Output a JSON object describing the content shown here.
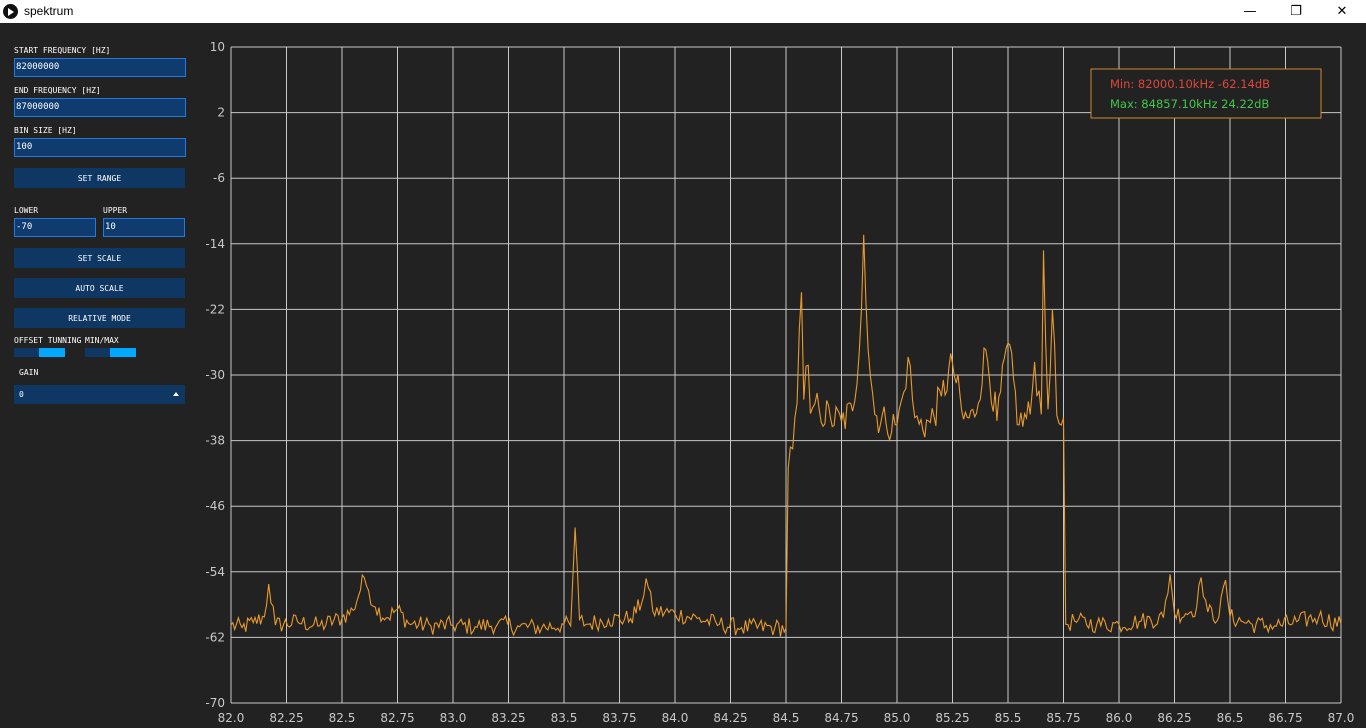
{
  "window": {
    "title": "spektrum",
    "minimize_glyph": "—",
    "restore_glyph": "❐",
    "close_glyph": "✕"
  },
  "sidebar": {
    "start_freq_label": "START FREQUENCY [HZ]",
    "start_freq_value": "82000000",
    "end_freq_label": "END FREQUENCY [HZ]",
    "end_freq_value": "87000000",
    "bin_size_label": "BIN SIZE [HZ]",
    "bin_size_value": "100",
    "set_range_label": "SET RANGE",
    "lower_label": "LOWER",
    "lower_value": "-70",
    "upper_label": "UPPER",
    "upper_value": "10",
    "set_scale_label": "SET SCALE",
    "auto_scale_label": "AUTO SCALE",
    "relative_mode_label": "RELATIVE MODE",
    "offset_tuning_label": "OFFSET TUNNING",
    "offset_tuning_on": true,
    "minmax_label": "MIN/MAX",
    "minmax_on": true,
    "gain_label": "GAIN",
    "gain_value": "0"
  },
  "readout": {
    "min_text": "Min: 82000.10kHz -62.14dB",
    "max_text": "Max: 84857.10kHz 24.22dB",
    "min_color": "#e0463a",
    "max_color": "#3fc84a"
  },
  "chart_data": {
    "type": "line",
    "xlabel": "",
    "ylabel": "",
    "xlim": [
      82.0,
      87.0
    ],
    "ylim": [
      -70,
      10
    ],
    "x_ticks": [
      "82.0",
      "82.25",
      "82.5",
      "82.75",
      "83.0",
      "83.25",
      "83.5",
      "83.75",
      "84.0",
      "84.25",
      "84.5",
      "84.75",
      "85.0",
      "85.25",
      "85.5",
      "85.75",
      "86.0",
      "86.25",
      "86.5",
      "86.75",
      "87.0"
    ],
    "y_ticks": [
      "10",
      "2",
      "-6",
      "-14",
      "-22",
      "-30",
      "-38",
      "-46",
      "-54",
      "-62",
      "-70"
    ],
    "grid": true,
    "line_color": "#e89a2c",
    "series": [
      {
        "x": [
          82.0,
          82.05,
          82.1,
          82.15,
          82.17,
          82.2,
          82.3,
          82.4,
          82.5,
          82.55,
          82.6,
          82.62,
          82.65,
          82.7,
          82.75,
          82.8,
          82.9,
          83.0,
          83.1,
          83.2,
          83.3,
          83.4,
          83.5,
          83.53,
          83.55,
          83.57,
          83.6,
          83.7,
          83.8,
          83.85,
          83.87,
          83.9,
          84.0,
          84.1,
          84.2,
          84.3,
          84.45,
          84.5,
          84.51,
          84.53,
          84.55,
          84.56,
          84.57,
          84.58,
          84.6,
          84.61,
          84.63,
          84.65,
          84.7,
          84.75,
          84.8,
          84.83,
          84.85,
          84.87,
          84.9,
          84.95,
          85.0,
          85.03,
          85.05,
          85.08,
          85.1,
          85.15,
          85.2,
          85.25,
          85.3,
          85.35,
          85.4,
          85.45,
          85.5,
          85.55,
          85.6,
          85.62,
          85.65,
          85.66,
          85.68,
          85.7,
          85.72,
          85.74,
          85.75,
          85.76,
          85.8,
          85.9,
          86.0,
          86.1,
          86.2,
          86.23,
          86.25,
          86.3,
          86.35,
          86.37,
          86.4,
          86.45,
          86.48,
          86.5,
          86.55,
          86.6,
          86.7,
          86.8,
          86.9,
          87.0
        ],
        "y": [
          -60.5,
          -60.8,
          -60.2,
          -59.5,
          -55.5,
          -60.5,
          -60.1,
          -60.6,
          -59.6,
          -58.7,
          -54.7,
          -56.3,
          -58.3,
          -59.6,
          -58.6,
          -60.3,
          -60.6,
          -60.5,
          -60.7,
          -60.4,
          -60.7,
          -60.8,
          -60.4,
          -60.6,
          -48.6,
          -59.8,
          -60.4,
          -59.8,
          -59.7,
          -57.8,
          -54.8,
          -58.8,
          -59.1,
          -59.7,
          -60.4,
          -60.8,
          -60.8,
          -60.9,
          -41.4,
          -39.0,
          -33.4,
          -24.5,
          -19.9,
          -33.0,
          -28.8,
          -34.7,
          -33.5,
          -34.3,
          -35.2,
          -35.7,
          -34.4,
          -27.1,
          -12.9,
          -26.8,
          -34.8,
          -35.8,
          -36.1,
          -32.1,
          -27.8,
          -35.2,
          -36.0,
          -35.8,
          -32.6,
          -28.6,
          -35.4,
          -35.1,
          -26.9,
          -35.6,
          -26.1,
          -36.1,
          -34.8,
          -28.4,
          -34.8,
          -14.8,
          -34.2,
          -22.0,
          -34.9,
          -36.1,
          -35.2,
          -60.4,
          -60.0,
          -60.4,
          -60.4,
          -60.0,
          -59.6,
          -54.3,
          -59.1,
          -59.1,
          -58.3,
          -54.7,
          -58.9,
          -59.5,
          -55.0,
          -59.5,
          -60.0,
          -60.4,
          -60.6,
          -60.1,
          -59.5,
          -60.4
        ]
      }
    ]
  }
}
